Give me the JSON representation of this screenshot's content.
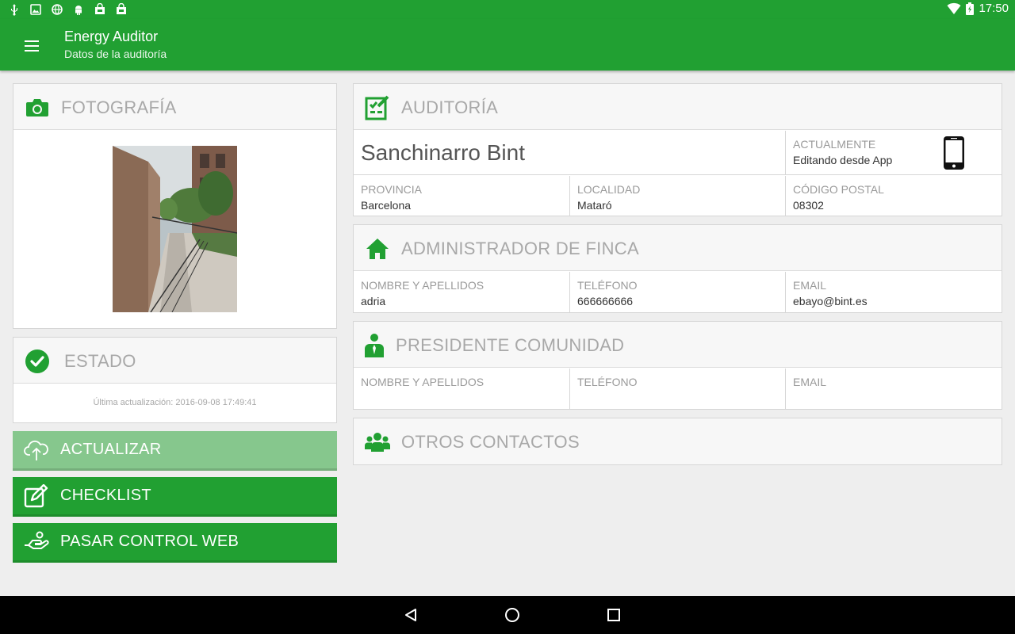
{
  "status_bar": {
    "time": "17:50",
    "left_icons": [
      "usb-icon",
      "image-icon",
      "globe-icon",
      "android-icon",
      "store-icon",
      "store-icon"
    ],
    "right_icons": [
      "wifi-icon",
      "battery-charging-icon"
    ]
  },
  "app_bar": {
    "title": "Energy Auditor",
    "subtitle": "Datos de la auditoría",
    "menu_icon": "menu-icon"
  },
  "colors": {
    "brand": "#21a032",
    "brand_light": "#86c78d",
    "header_text": "#a8a8a8"
  },
  "photo_card": {
    "title": "FOTOGRAFÍA",
    "icon": "camera-icon"
  },
  "estado_card": {
    "title": "ESTADO",
    "icon": "check-circle-icon",
    "updated_text": "Última actualización: 2016-09-08 17:49:41"
  },
  "actions": [
    {
      "label": "ACTUALIZAR",
      "icon": "cloud-upload-icon"
    },
    {
      "label": "CHECKLIST",
      "icon": "edit-icon"
    },
    {
      "label": "PASAR CONTROL WEB",
      "icon": "hand-icon"
    }
  ],
  "auditoria": {
    "title": "AUDITORÍA",
    "icon": "checklist-icon",
    "name": "Sanchinarro Bint",
    "actualmente_label": "ACTUALMENTE",
    "actualmente_value": "Editando desde App",
    "device_icon": "smartphone-icon",
    "provincia_label": "PROVINCIA",
    "provincia_value": "Barcelona",
    "localidad_label": "LOCALIDAD",
    "localidad_value": "Mataró",
    "cp_label": "CÓDIGO POSTAL",
    "cp_value": "08302"
  },
  "administrador": {
    "title": "ADMINISTRADOR DE FINCA",
    "icon": "home-icon",
    "nombre_label": "NOMBRE Y APELLIDOS",
    "nombre_value": "adria",
    "telefono_label": "TELÉFONO",
    "telefono_value": "666666666",
    "email_label": "EMAIL",
    "email_value": "ebayo@bint.es"
  },
  "presidente": {
    "title": "PRESIDENTE COMUNIDAD",
    "icon": "person-tie-icon",
    "nombre_label": "NOMBRE Y APELLIDOS",
    "nombre_value": "",
    "telefono_label": "TELÉFONO",
    "telefono_value": "",
    "email_label": "EMAIL",
    "email_value": ""
  },
  "otros": {
    "title": "OTROS CONTACTOS",
    "icon": "group-icon"
  },
  "nav_bar": {
    "icons": [
      "back-icon",
      "home-nav-icon",
      "recents-icon"
    ]
  }
}
